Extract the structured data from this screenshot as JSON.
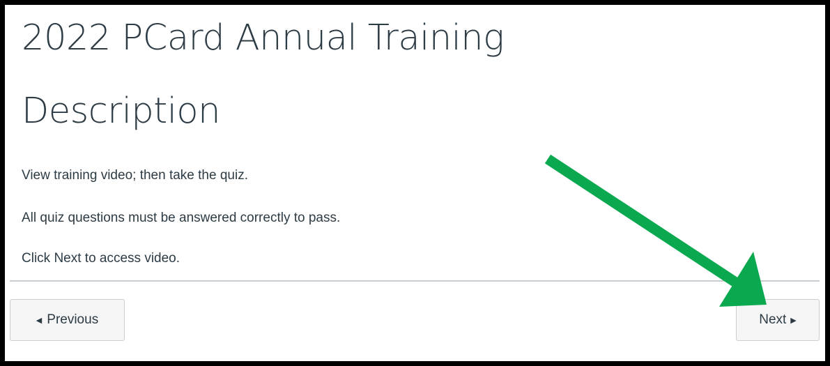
{
  "page": {
    "title": "2022 PCard Annual Training",
    "section_heading": "Description",
    "paragraphs": [
      "View training video; then take the quiz.",
      "All quiz questions must be answered correctly to pass.",
      "Click Next to access video."
    ]
  },
  "navigation": {
    "previous_label": "Previous",
    "next_label": "Next"
  },
  "icons": {
    "previous_caret": "caret-left-icon",
    "next_caret": "caret-right-icon",
    "annotation": "green-arrow-icon"
  },
  "colors": {
    "text": "#2d3b45",
    "frame": "#000000",
    "button_bg": "#f5f5f5",
    "button_border": "#c7cdd1",
    "annotation_arrow": "#0aa84f"
  }
}
